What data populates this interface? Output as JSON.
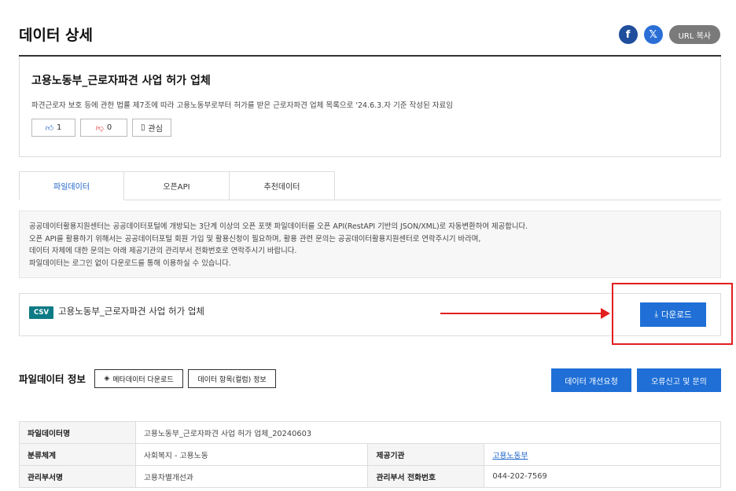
{
  "header": {
    "title": "데이터 상세",
    "url_copy_label": "URL 복사"
  },
  "dataset": {
    "title": "고용노동부_근로자파견 사업 허가 업체",
    "description": "파견근로자 보호 등에 관한 법률 제7조에 따라 고용노동부로부터 허가를 받은 근로자파견 업체 목록으로 '24.6.3.자 기준 작성된 자료임",
    "likes": "1",
    "dislikes": "0",
    "interest_label": "관심"
  },
  "tabs": [
    {
      "label": "파일데이터"
    },
    {
      "label": "오픈API"
    },
    {
      "label": "추천데이터"
    }
  ],
  "notice": {
    "line1": "공공데이터활용지원센터는 공공데이터포털에 개방되는 3단계 이상의 오픈 포맷 파일데이터를 오픈 API(RestAPI 기반의 JSON/XML)로 자동변환하여 제공합니다.",
    "line2": "오픈 API를 활용하기 위해서는 공공데이터포털 회원 가입 및 활용신청이 필요하며, 활용 관련 문의는 공공데이터활용지원센터로 연락주시기 바라며,",
    "line3": "데이터 자체에 대한 문의는 아래 제공기관의 관리부서 전화번호로 연락주시기 바랍니다.",
    "line4": "파일데이터는 로그인 없이 다운로드를 통해 이용하실 수 있습니다."
  },
  "file": {
    "badge": "CSV",
    "name": "고용노동부_근로자파견 사업 허가 업체",
    "download_label": "다운로드"
  },
  "file_info": {
    "title": "파일데이터 정보",
    "meta_download_label": "메타데이터 다운로드",
    "column_info_label": "데이터 항목(컬럼) 정보",
    "improve_label": "데이터 개선요청",
    "report_label": "오류신고 및 문의"
  },
  "meta_table": {
    "file_name_label": "파일데이터명",
    "file_name_value": "고용노동부_근로자파견 사업 허가 업체_20240603",
    "category_label": "분류체계",
    "category_value": "사회복지 - 고용노동",
    "provider_label": "제공기관",
    "provider_value": "고용노동부",
    "dept_label": "관리부서명",
    "dept_value": "고용차별개선과",
    "phone_label": "관리부서 전화번호",
    "phone_value": "044-202-7569"
  }
}
